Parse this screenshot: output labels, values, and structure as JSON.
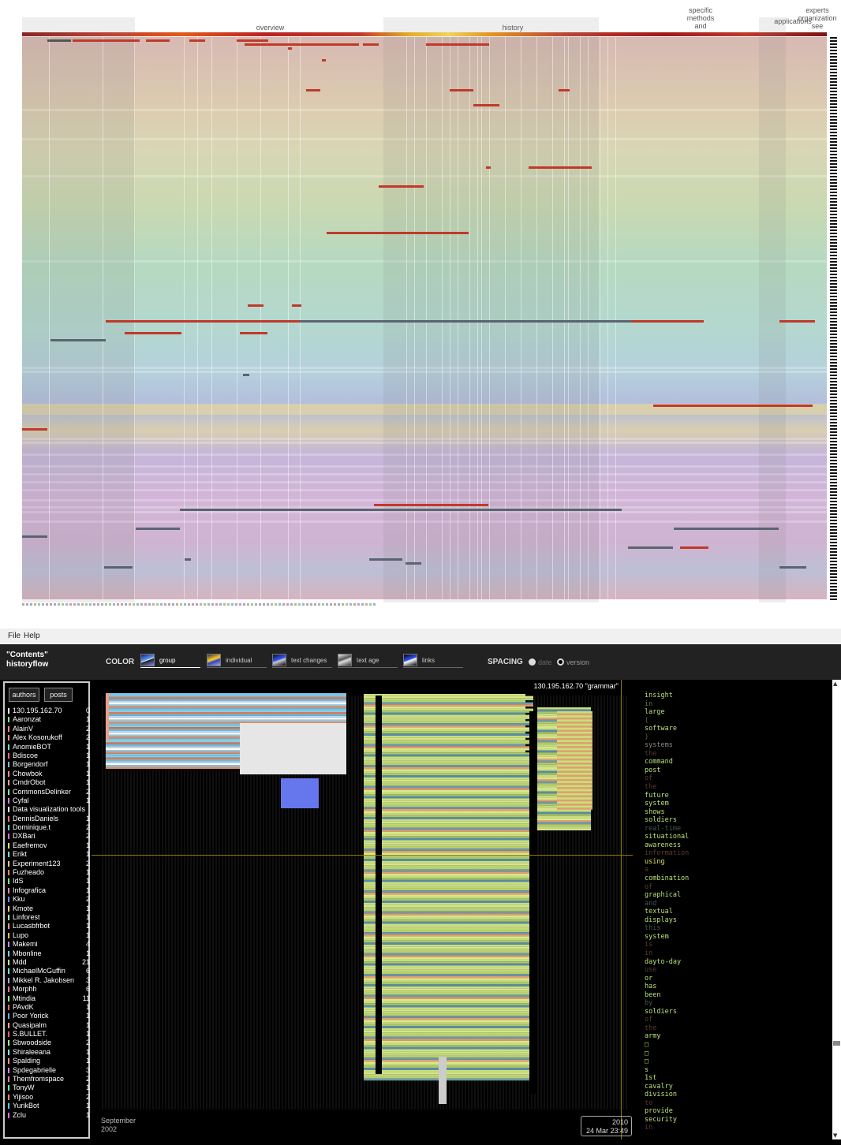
{
  "overview": {
    "sections": [
      "overview",
      "history",
      "specific methods and",
      "applications",
      "experts organization see"
    ]
  },
  "app": {
    "menu": [
      "File",
      "Help"
    ],
    "title": "\"Contents\"\nhistoryflow",
    "color_label": "COLOR",
    "color_options": [
      "group",
      "individual",
      "text changes",
      "text age",
      "links"
    ],
    "color_selected": "group",
    "spacing_label": "SPACING",
    "spacing_options": [
      "date",
      "version"
    ],
    "spacing_selected": "version",
    "tabs": [
      "authors",
      "posts"
    ],
    "flow_label": "130.195.162.70 \"grammar\"",
    "date_start": "September\n2002",
    "date_current": "2010\n24 Mar 23:49"
  },
  "authors": [
    {
      "name": "130.195.162.70",
      "count": "0",
      "color": "#ffffff"
    },
    {
      "name": "Aaronzat",
      "count": "1",
      "color": "#88ee88"
    },
    {
      "name": "AlainV",
      "count": "2",
      "color": "#ff8888"
    },
    {
      "name": "Alex Kosorukoff",
      "count": "2",
      "color": "#ff9966"
    },
    {
      "name": "AnomieBOT",
      "count": "1",
      "color": "#66ddcc"
    },
    {
      "name": "Bdiscoe",
      "count": "1",
      "color": "#ff6688"
    },
    {
      "name": "Borgendorf",
      "count": "1",
      "color": "#99aaff"
    },
    {
      "name": "Chowbok",
      "count": "1",
      "color": "#ff8899"
    },
    {
      "name": "CmdrObot",
      "count": "1",
      "color": "#ffaa66"
    },
    {
      "name": "CommonsDelinker",
      "count": "2",
      "color": "#88ff99"
    },
    {
      "name": "Cyfal",
      "count": "1",
      "color": "#cc88ff"
    },
    {
      "name": "Data visualization tools",
      "count": "",
      "color": "#ffffff"
    },
    {
      "name": "DennisDaniels",
      "count": "1",
      "color": "#ff7777"
    },
    {
      "name": "Dominique.t",
      "count": "2",
      "color": "#66ccff"
    },
    {
      "name": "DXBari",
      "count": "2",
      "color": "#ff66cc"
    },
    {
      "name": "Eaefremov",
      "count": "1",
      "color": "#ccff66"
    },
    {
      "name": "Erikt",
      "count": "1",
      "color": "#66ffcc"
    },
    {
      "name": "Experiment123",
      "count": "2",
      "color": "#ffcc66"
    },
    {
      "name": "Fuzheado",
      "count": "1",
      "color": "#ff8866"
    },
    {
      "name": "IdS",
      "count": "1",
      "color": "#88ff66"
    },
    {
      "name": "Infografica",
      "count": "1",
      "color": "#ff88aa"
    },
    {
      "name": "Kku",
      "count": "2",
      "color": "#6699ff"
    },
    {
      "name": "Kmote",
      "count": "1",
      "color": "#ffcc99"
    },
    {
      "name": "Linforest",
      "count": "1",
      "color": "#99ffcc"
    },
    {
      "name": "Lucasbfrbot",
      "count": "1",
      "color": "#ff9999"
    },
    {
      "name": "Lupo",
      "count": "1",
      "color": "#ffbb44"
    },
    {
      "name": "Makemi",
      "count": "4",
      "color": "#bb88ff"
    },
    {
      "name": "Mbonline",
      "count": "1",
      "color": "#66ddff"
    },
    {
      "name": "Mdd",
      "count": "21",
      "color": "#ccff88"
    },
    {
      "name": "MichaelMcGuffin",
      "count": "6",
      "color": "#66ffdd"
    },
    {
      "name": "Mikkel R. Jakobsen",
      "count": "3",
      "color": "#aaaaff"
    },
    {
      "name": "Morphh",
      "count": "6",
      "color": "#ff7799"
    },
    {
      "name": "Mtindia",
      "count": "11",
      "color": "#99ff77"
    },
    {
      "name": "PAvdK",
      "count": "1",
      "color": "#ff6666"
    },
    {
      "name": "Poor Yorick",
      "count": "1",
      "color": "#66aaff"
    },
    {
      "name": "Quasipalm",
      "count": "1",
      "color": "#ffaa88"
    },
    {
      "name": "S.BULLET.",
      "count": "1",
      "color": "#ff5577"
    },
    {
      "name": "Sbwoodside",
      "count": "2",
      "color": "#aaff88"
    },
    {
      "name": "Shiraleeana",
      "count": "1",
      "color": "#88ffee"
    },
    {
      "name": "Spalding",
      "count": "1",
      "color": "#ff9977"
    },
    {
      "name": "Spdegabrielle",
      "count": "3",
      "color": "#dd88ff"
    },
    {
      "name": "Themfromspace",
      "count": "2",
      "color": "#ff77bb"
    },
    {
      "name": "TonyW",
      "count": "1",
      "color": "#66ffaa"
    },
    {
      "name": "Yijisoo",
      "count": "2",
      "color": "#ff8855"
    },
    {
      "name": "YurikBot",
      "count": "1",
      "color": "#55ccff"
    },
    {
      "name": "Zclu",
      "count": "1",
      "color": "#ff66ff"
    }
  ],
  "words": [
    {
      "t": "insight",
      "c": "#b8e07a"
    },
    {
      "t": "in",
      "c": "#5f7a3a"
    },
    {
      "t": "large",
      "c": "#b8e07a"
    },
    {
      "t": "(",
      "c": "#5f7a3a"
    },
    {
      "t": "software",
      "c": "#b8e07a"
    },
    {
      "t": ")",
      "c": "#5f7a3a"
    },
    {
      "t": "systems",
      "c": "#888888"
    },
    {
      "t": "the",
      "c": "#5a3a30"
    },
    {
      "t": "command",
      "c": "#b8e07a"
    },
    {
      "t": "post",
      "c": "#b8e07a"
    },
    {
      "t": "of",
      "c": "#5a3a30"
    },
    {
      "t": "the",
      "c": "#5a3a30"
    },
    {
      "t": "future",
      "c": "#b8e07a"
    },
    {
      "t": "system",
      "c": "#b8e07a"
    },
    {
      "t": "shows",
      "c": "#b8e07a"
    },
    {
      "t": "soldiers",
      "c": "#b8e07a"
    },
    {
      "t": "real-time",
      "c": "#3e5a50"
    },
    {
      "t": "situational",
      "c": "#b8e07a"
    },
    {
      "t": "awareness",
      "c": "#b8e07a"
    },
    {
      "t": "information",
      "c": "#5a3a30"
    },
    {
      "t": "using",
      "c": "#e0e060"
    },
    {
      "t": "a",
      "c": "#5a3a30"
    },
    {
      "t": "combination",
      "c": "#b8e07a"
    },
    {
      "t": "of",
      "c": "#5a3a30"
    },
    {
      "t": "graphical",
      "c": "#b8e07a"
    },
    {
      "t": "and",
      "c": "#3e5a50"
    },
    {
      "t": "textual",
      "c": "#b8e07a"
    },
    {
      "t": "displays",
      "c": "#b8e07a"
    },
    {
      "t": "this",
      "c": "#3e5a50"
    },
    {
      "t": "system",
      "c": "#b8e07a"
    },
    {
      "t": "is",
      "c": "#5a3a30"
    },
    {
      "t": "in",
      "c": "#5a3a30"
    },
    {
      "t": "dayto-day",
      "c": "#b8e07a"
    },
    {
      "t": "use",
      "c": "#5a3a30"
    },
    {
      "t": "or",
      "c": "#b8e07a"
    },
    {
      "t": "has",
      "c": "#b8e07a"
    },
    {
      "t": "been",
      "c": "#b8e07a"
    },
    {
      "t": "by",
      "c": "#3e5a50"
    },
    {
      "t": "soldiers",
      "c": "#b8e07a"
    },
    {
      "t": "of",
      "c": "#5a3a30"
    },
    {
      "t": "the",
      "c": "#5a3a30"
    },
    {
      "t": "army",
      "c": "#b8e07a"
    },
    {
      "t": "□",
      "c": "#b8e07a"
    },
    {
      "t": "□",
      "c": "#b8e07a"
    },
    {
      "t": "□",
      "c": "#b8e07a"
    },
    {
      "t": "s",
      "c": "#b8e07a"
    },
    {
      "t": "1st",
      "c": "#b8e07a"
    },
    {
      "t": "cavalry",
      "c": "#b8e07a"
    },
    {
      "t": "division",
      "c": "#b8e07a"
    },
    {
      "t": "to",
      "c": "#5a3a30"
    },
    {
      "t": "provide",
      "c": "#b8e07a"
    },
    {
      "t": "security",
      "c": "#b8e07a"
    },
    {
      "t": "in",
      "c": "#5a3a30"
    }
  ]
}
